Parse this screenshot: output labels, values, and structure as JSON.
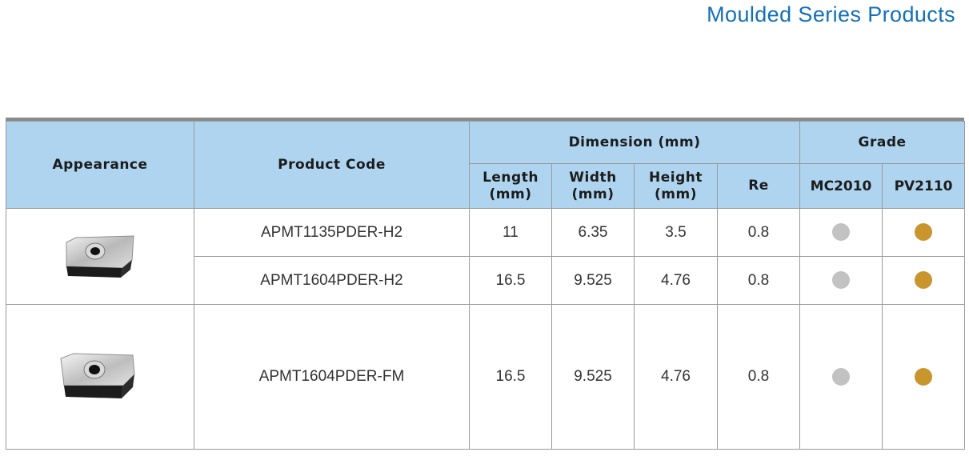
{
  "page": {
    "title": "Moulded Series Products"
  },
  "table": {
    "headers": {
      "appearance": "Appearance",
      "product_code": "Product Code",
      "dimension": "Dimension (mm)",
      "grade": "Grade",
      "length": "Length\n(mm)",
      "width": "Width\n(mm)",
      "height": "Height\n(mm)",
      "re": "Re",
      "grade_a": "MC2010",
      "grade_b": "PV2110"
    },
    "rows": [
      {
        "code": "APMT1135PDER-H2",
        "length": "11",
        "width": "6.35",
        "height": "3.5",
        "re": "0.8",
        "grade_a": true,
        "grade_b": true
      },
      {
        "code": "APMT1604PDER-H2",
        "length": "16.5",
        "width": "9.525",
        "height": "4.76",
        "re": "0.8",
        "grade_a": true,
        "grade_b": true
      },
      {
        "code": "APMT1604PDER-FM",
        "length": "16.5",
        "width": "9.525",
        "height": "4.76",
        "re": "0.8",
        "grade_a": true,
        "grade_b": true
      }
    ],
    "images": [
      "insert-h2-image",
      "insert-fm-image"
    ],
    "colors": {
      "header_bg": "#aed4ef",
      "grade_a_dot": "#c2c2c2",
      "grade_b_dot": "#c9962e",
      "title": "#1270b8"
    }
  }
}
